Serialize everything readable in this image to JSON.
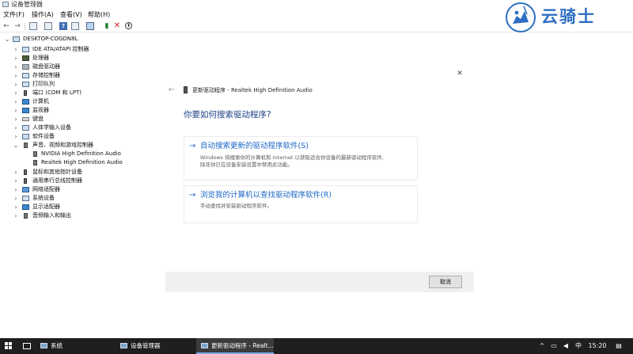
{
  "window": {
    "title": "设备管理器"
  },
  "menubar": {
    "items": [
      "文件(F)",
      "操作(A)",
      "查看(V)",
      "帮助(H)"
    ]
  },
  "toolbar": {
    "back_icon": "←",
    "forward_icon": "→",
    "icons": [
      "arrow-left-icon",
      "arrow-right-icon",
      "properties-icon",
      "list-icon",
      "help-icon",
      "display-icon",
      "monitor-icon",
      "update-driver-icon",
      "uninstall-icon",
      "download-icon"
    ]
  },
  "tree": {
    "root": "DESKTOP-COGDN8L",
    "expand_collapsed": "›",
    "expand_open": "⌄",
    "categories": [
      {
        "label": "IDE ATA/ATAPI 控制器",
        "icon": "ide-controller-icon"
      },
      {
        "label": "处理器",
        "icon": "processor-icon"
      },
      {
        "label": "磁盘驱动器",
        "icon": "disk-drive-icon"
      },
      {
        "label": "存储控制器",
        "icon": "storage-controller-icon"
      },
      {
        "label": "打印队列",
        "icon": "print-queue-icon"
      },
      {
        "label": "端口 (COM 和 LPT)",
        "icon": "port-icon"
      },
      {
        "label": "计算机",
        "icon": "computer-icon"
      },
      {
        "label": "监视器",
        "icon": "monitor-icon"
      },
      {
        "label": "键盘",
        "icon": "keyboard-icon"
      },
      {
        "label": "人体学输入设备",
        "icon": "hid-icon"
      },
      {
        "label": "软件设备",
        "icon": "software-device-icon"
      },
      {
        "label": "声音、视频和游戏控制器",
        "icon": "sound-icon",
        "expanded": true,
        "children": [
          "NVIDIA High Definition Audio",
          "Realtek High Definition Audio"
        ]
      },
      {
        "label": "鼠标和其他指针设备",
        "icon": "mouse-icon"
      },
      {
        "label": "通用串行总线控制器",
        "icon": "usb-icon"
      },
      {
        "label": "网络适配器",
        "icon": "network-adapter-icon"
      },
      {
        "label": "系统设备",
        "icon": "system-device-icon"
      },
      {
        "label": "显示适配器",
        "icon": "display-adapter-icon"
      },
      {
        "label": "音频输入和输出",
        "icon": "audio-io-icon"
      }
    ]
  },
  "wizard": {
    "close_glyph": "✕",
    "back_glyph": "←",
    "title": "更新驱动程序 - Realtek High Definition Audio",
    "heading": "你要如何搜索驱动程序?",
    "options": [
      {
        "arrow": "→",
        "title": "自动搜索更新的驱动程序软件(S)",
        "desc_lines": [
          "Windows 将搜索你的计算机和 Internet 以获取适合你设备的最新驱动程序软件,",
          "除非你已在设备安装设置中禁用此功能。"
        ]
      },
      {
        "arrow": "→",
        "title": "浏览我的计算机以查找驱动程序软件(R)",
        "desc_lines": [
          "手动查找并安装驱动程序软件。"
        ]
      }
    ],
    "cancel_label": "取消"
  },
  "watermark": {
    "text": "云骑士"
  },
  "taskbar": {
    "items": [
      {
        "label": "系统",
        "active": false
      },
      {
        "label": "设备管理器",
        "active": false
      },
      {
        "label": "更新驱动程序 - Realt...",
        "active": true
      }
    ],
    "tray": {
      "chevron": "^",
      "ime": "中",
      "time": "15:20"
    }
  },
  "colors": {
    "link_blue": "#1c67c7",
    "heading_blue": "#1a3f84",
    "taskbar": "#1f1f1f",
    "watermark": "#2d6fc2"
  }
}
